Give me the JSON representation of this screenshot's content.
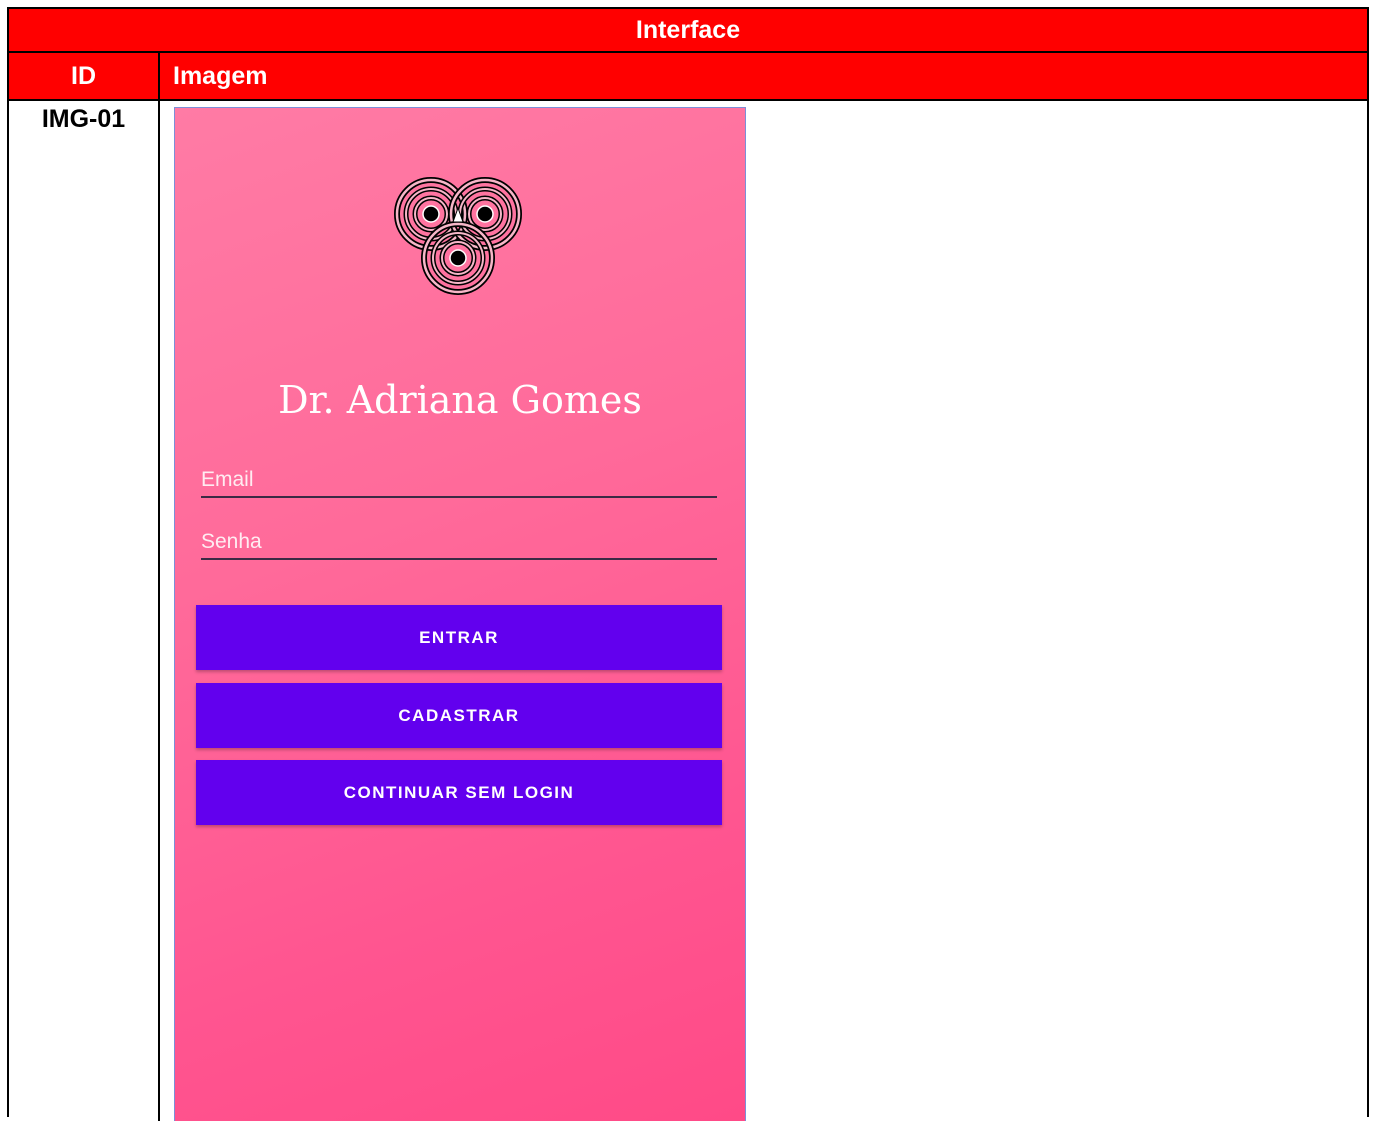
{
  "table": {
    "title": "Interface",
    "col_id": "ID",
    "col_image": "Imagem",
    "row_id": "IMG-01"
  },
  "app": {
    "title": "Dr. Adriana Gomes",
    "logo_icon": "triple-spiral-icon",
    "email_placeholder": "Email",
    "password_placeholder": "Senha",
    "buttons": {
      "login": "ENTRAR",
      "register": "CADASTRAR",
      "guest": "CONTINUAR SEM LOGIN"
    },
    "colors": {
      "header_red": "#ff0000",
      "button_purple": "#6200ee",
      "gradient_top": "#ff7ba5",
      "gradient_bottom": "#ff4a87"
    }
  }
}
